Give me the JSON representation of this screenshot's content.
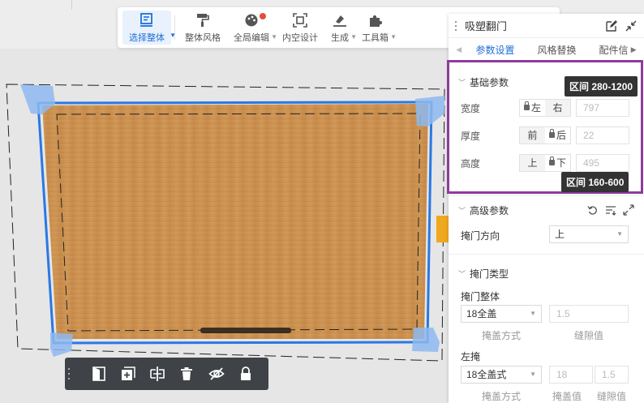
{
  "toolbar": {
    "items": [
      {
        "label": "选择整体",
        "icon": "select-all-icon"
      },
      {
        "label": "整体风格",
        "icon": "paint-roller-icon"
      },
      {
        "label": "全局编辑",
        "icon": "palette-icon"
      },
      {
        "label": "内空设计",
        "icon": "inner-space-icon"
      },
      {
        "label": "生成",
        "icon": "generate-icon"
      },
      {
        "label": "工具箱",
        "icon": "puzzle-icon"
      }
    ]
  },
  "panel": {
    "title": "吸塑翻门",
    "tabs": [
      "参数设置",
      "风格替换",
      "配件信"
    ],
    "basic": {
      "title": "基础参数",
      "rows": [
        {
          "label": "宽度",
          "opt_a": "左",
          "opt_b": "右",
          "value": "797"
        },
        {
          "label": "厚度",
          "opt_a": "前",
          "opt_b": "后",
          "value": "22"
        },
        {
          "label": "高度",
          "opt_a": "上",
          "opt_b": "下",
          "value": "495"
        }
      ],
      "tooltip_width": "区间 280-1200",
      "tooltip_height": "区间 160-600"
    },
    "advanced": {
      "title": "高级参数",
      "direction_label": "掩门方向",
      "direction_value": "上"
    },
    "door_type": {
      "title": "掩门类型",
      "whole_label": "掩门整体",
      "whole_select": "18全盖",
      "whole_gap": "1.5",
      "whole_sub_a": "掩盖方式",
      "whole_sub_b": "缝隙值",
      "left_label": "左掩",
      "left_select": "18全盖式",
      "left_val_1": "18",
      "left_val_2": "1.5",
      "left_sub_a": "掩盖方式",
      "left_sub_b": "掩盖值",
      "left_sub_c": "缝隙值"
    }
  },
  "colors": {
    "accent": "#1e6fd9",
    "highlight": "#8e3b9c",
    "wood": "#c8904f",
    "selection": "#2a78e4"
  }
}
